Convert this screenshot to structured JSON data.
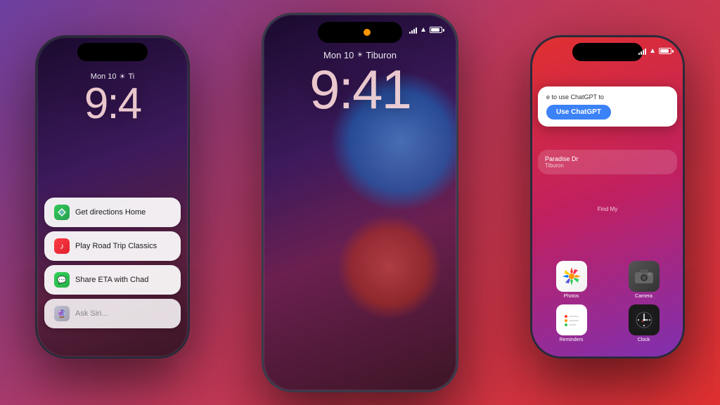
{
  "background": {
    "gradient": "purple to red"
  },
  "phones": {
    "left": {
      "date": "Mon 10",
      "location": "Ti",
      "time": "9:4",
      "siri_suggestions": [
        {
          "id": "directions",
          "icon": "maps",
          "text": "Get directions Home"
        },
        {
          "id": "music",
          "icon": "music",
          "text": "Play Road Trip Classics"
        },
        {
          "id": "messages",
          "icon": "messages",
          "text": "Share ETA with Chad"
        }
      ],
      "ask_siri_placeholder": "Ask Siri..."
    },
    "center": {
      "date": "Mon 10",
      "location": "Tiburon",
      "time": "9:41"
    },
    "right": {
      "chatgpt_prompt": "e to use ChatGPT to",
      "chatgpt_button": "Use ChatGPT",
      "maps_label": "Find My",
      "maps_destination": "Paradise Dr",
      "maps_location": "Tiburon",
      "apps": [
        {
          "name": "Photos",
          "icon": "photos"
        },
        {
          "name": "Camera",
          "icon": "camera"
        },
        {
          "name": "Reminders",
          "icon": "reminders"
        },
        {
          "name": "Clock",
          "icon": "clock"
        }
      ]
    }
  }
}
